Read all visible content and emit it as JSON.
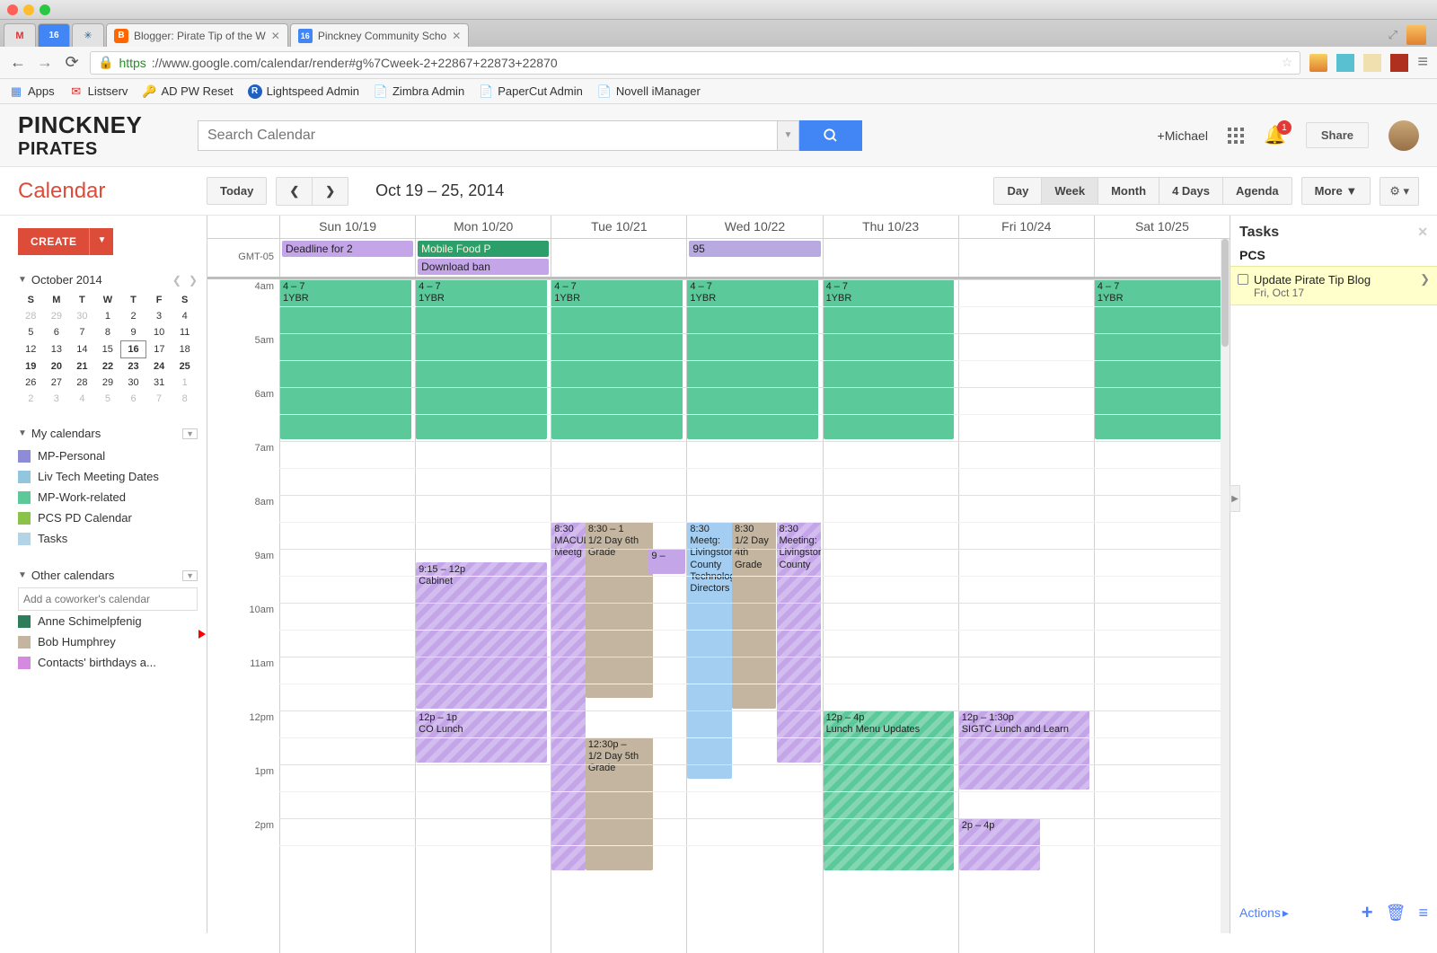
{
  "browser": {
    "tabs": [
      {
        "pinned": true,
        "icon": "M"
      },
      {
        "pinned": true,
        "icon": "16"
      },
      {
        "pinned": true,
        "icon": "✳"
      },
      {
        "pinned": false,
        "favicon": "B",
        "title": "Blogger: Pirate Tip of the W"
      },
      {
        "pinned": false,
        "favicon": "16",
        "title": "Pinckney Community Scho"
      }
    ],
    "url_prefix": "https",
    "url_rest": "://www.google.com/calendar/render#g%7Cweek-2+22867+22873+22870",
    "bookmarks": [
      {
        "icon": "⠿",
        "label": "Apps"
      },
      {
        "icon": "✉",
        "label": "Listserv"
      },
      {
        "icon": "🔑",
        "label": "AD PW Reset"
      },
      {
        "icon": "R",
        "label": "Lightspeed Admin"
      },
      {
        "icon": "📄",
        "label": "Zimbra Admin"
      },
      {
        "icon": "📄",
        "label": "PaperCut Admin"
      },
      {
        "icon": "📄",
        "label": "Novell iManager"
      }
    ]
  },
  "google": {
    "logo_top": "PINCKNEY",
    "logo_bottom": "PIRATES",
    "search_placeholder": "Search Calendar",
    "user": "+Michael",
    "notifications": "1",
    "share": "Share"
  },
  "calendar": {
    "brand": "Calendar",
    "today": "Today",
    "date_range": "Oct 19 – 25, 2014",
    "views": [
      "Day",
      "Week",
      "Month",
      "4 Days",
      "Agenda"
    ],
    "active_view": "Week",
    "more": "More",
    "create": "CREATE"
  },
  "minical": {
    "title": "October 2014",
    "dow": [
      "S",
      "M",
      "T",
      "W",
      "T",
      "F",
      "S"
    ],
    "weeks": [
      [
        {
          "d": "28",
          "o": true
        },
        {
          "d": "29",
          "o": true
        },
        {
          "d": "30",
          "o": true
        },
        {
          "d": "1"
        },
        {
          "d": "2"
        },
        {
          "d": "3"
        },
        {
          "d": "4"
        }
      ],
      [
        {
          "d": "5"
        },
        {
          "d": "6"
        },
        {
          "d": "7"
        },
        {
          "d": "8"
        },
        {
          "d": "9"
        },
        {
          "d": "10"
        },
        {
          "d": "11"
        }
      ],
      [
        {
          "d": "12"
        },
        {
          "d": "13"
        },
        {
          "d": "14"
        },
        {
          "d": "15"
        },
        {
          "d": "16",
          "t": true
        },
        {
          "d": "17"
        },
        {
          "d": "18"
        }
      ],
      [
        {
          "d": "19",
          "sw": true
        },
        {
          "d": "20",
          "sw": true
        },
        {
          "d": "21",
          "sw": true
        },
        {
          "d": "22",
          "sw": true
        },
        {
          "d": "23",
          "sw": true
        },
        {
          "d": "24",
          "sw": true
        },
        {
          "d": "25",
          "sw": true
        }
      ],
      [
        {
          "d": "26"
        },
        {
          "d": "27"
        },
        {
          "d": "28"
        },
        {
          "d": "29"
        },
        {
          "d": "30"
        },
        {
          "d": "31"
        },
        {
          "d": "1",
          "o": true
        }
      ],
      [
        {
          "d": "2",
          "o": true
        },
        {
          "d": "3",
          "o": true
        },
        {
          "d": "4",
          "o": true
        },
        {
          "d": "5",
          "o": true
        },
        {
          "d": "6",
          "o": true
        },
        {
          "d": "7",
          "o": true
        },
        {
          "d": "8",
          "o": true
        }
      ]
    ]
  },
  "my_calendars": {
    "header": "My calendars",
    "items": [
      {
        "color": "#8e8cd8",
        "name": "MP-Personal"
      },
      {
        "color": "#92c5de",
        "name": "Liv Tech Meeting Dates"
      },
      {
        "color": "#5bc99a",
        "name": "MP-Work-related"
      },
      {
        "color": "#8bc34a",
        "name": "PCS PD Calendar"
      },
      {
        "color": "#b3d4e6",
        "name": "Tasks"
      }
    ]
  },
  "other_calendars": {
    "header": "Other calendars",
    "placeholder": "Add a coworker's calendar",
    "items": [
      {
        "color": "#2e7d5a",
        "name": "Anne Schimelpfenig"
      },
      {
        "color": "#c4b5a0",
        "name": "Bob Humphrey"
      },
      {
        "color": "#d48adf",
        "name": "Contacts' birthdays a..."
      }
    ]
  },
  "week": {
    "timezone": "GMT-05",
    "days": [
      {
        "label": "Sun 10/19"
      },
      {
        "label": "Mon 10/20"
      },
      {
        "label": "Tue 10/21"
      },
      {
        "label": "Wed 10/22"
      },
      {
        "label": "Thu 10/23"
      },
      {
        "label": "Fri 10/24"
      },
      {
        "label": "Sat 10/25"
      }
    ],
    "allday": [
      [
        {
          "text": "Deadline for 2",
          "color": "c-purple"
        }
      ],
      [
        {
          "text": "Mobile Food P",
          "color": "c-green-d"
        },
        {
          "text": "Download ban",
          "color": "c-purple"
        }
      ],
      [],
      [
        {
          "text": "95",
          "color": "c-lav"
        }
      ],
      [],
      [],
      []
    ],
    "hours": [
      "4am",
      "5am",
      "6am",
      "7am",
      "8am",
      "9am",
      "10am",
      "11am",
      "12pm",
      "1pm",
      "2pm"
    ],
    "hour_height": 60,
    "events": [
      {
        "day": 0,
        "start": 0,
        "dur": 3,
        "time": "4 – 7",
        "title": "1YBR",
        "color": "c-green"
      },
      {
        "day": 1,
        "start": 0,
        "dur": 3,
        "time": "4 – 7",
        "title": "1YBR",
        "color": "c-green"
      },
      {
        "day": 2,
        "start": 0,
        "dur": 3,
        "time": "4 – 7",
        "title": "1YBR",
        "color": "c-green"
      },
      {
        "day": 3,
        "start": 0,
        "dur": 3,
        "time": "4 – 7",
        "title": "1YBR",
        "color": "c-green"
      },
      {
        "day": 4,
        "start": 0,
        "dur": 3,
        "time": "4 – 7",
        "title": "1YBR",
        "color": "c-green"
      },
      {
        "day": 6,
        "start": 0,
        "dur": 3,
        "time": "4 – 7",
        "title": "1YBR",
        "color": "c-green"
      },
      {
        "day": 1,
        "start": 5.25,
        "dur": 2.75,
        "time": "9:15 – 12p",
        "title": "Cabinet",
        "color": "c-purple",
        "hatch": true
      },
      {
        "day": 1,
        "start": 8,
        "dur": 1,
        "time": "12p – 1p",
        "title": "CO Lunch",
        "color": "c-purple",
        "hatch": true
      },
      {
        "day": 2,
        "start": 4.5,
        "dur": 6.5,
        "time": "8:30",
        "title": "MACUL Meetg",
        "color": "c-purple",
        "hatch": true,
        "left": 0,
        "width": 0.25
      },
      {
        "day": 2,
        "start": 4.5,
        "dur": 3.3,
        "time": "8:30 – 1",
        "title": "1/2 Day 6th Grade",
        "color": "c-brown",
        "left": 0.25,
        "width": 0.5
      },
      {
        "day": 2,
        "start": 5,
        "dur": 0.5,
        "time": "9 –",
        "title": "",
        "color": "c-purple",
        "left": 0.72,
        "width": 0.27
      },
      {
        "day": 2,
        "start": 8.5,
        "dur": 2.5,
        "time": "12:30p –",
        "title": "1/2 Day 5th Grade",
        "color": "c-brown",
        "left": 0.25,
        "width": 0.5
      },
      {
        "day": 3,
        "start": 4.5,
        "dur": 4.8,
        "time": "8:30",
        "title": "Meetg: Livingston County Technology Directors",
        "color": "c-blue",
        "left": 0,
        "width": 0.33
      },
      {
        "day": 3,
        "start": 4.5,
        "dur": 3.5,
        "time": "8:30",
        "title": "1/2 Day 4th Grade",
        "color": "c-brown",
        "left": 0.33,
        "width": 0.33
      },
      {
        "day": 3,
        "start": 4.5,
        "dur": 4.5,
        "time": "8:30",
        "title": "Meeting: Livingston County",
        "color": "c-purple",
        "hatch": true,
        "left": 0.66,
        "width": 0.33
      },
      {
        "day": 4,
        "start": 8,
        "dur": 3,
        "time": "12p – 4p",
        "title": "Lunch Menu Updates",
        "color": "c-green",
        "hatch": true
      },
      {
        "day": 5,
        "start": 8,
        "dur": 1.5,
        "time": "12p – 1:30p",
        "title": "SIGTC Lunch and Learn",
        "color": "c-purple",
        "hatch": true
      },
      {
        "day": 5,
        "start": 10,
        "dur": 1,
        "time": "2p – 4p",
        "title": "",
        "color": "c-purple",
        "hatch": true,
        "left": 0,
        "width": 0.6
      }
    ]
  },
  "tasks": {
    "header": "Tasks",
    "list_name": "PCS",
    "item": "Update Pirate Tip Blog",
    "due": "Fri, Oct 17",
    "actions": "Actions"
  }
}
